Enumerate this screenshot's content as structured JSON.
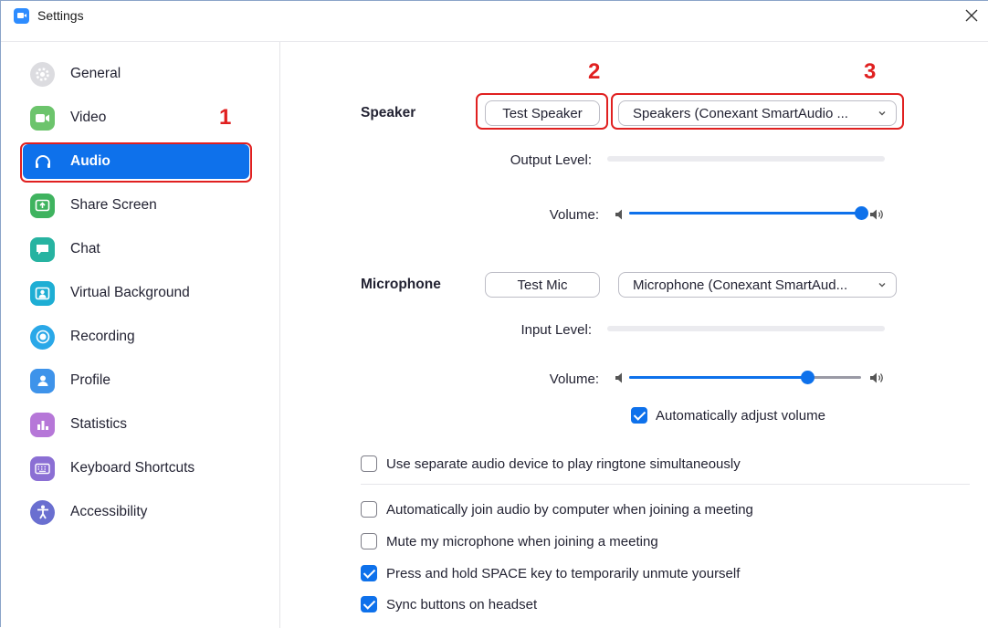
{
  "window": {
    "title": "Settings",
    "close_symbol": "✕"
  },
  "sidebar": {
    "items": [
      {
        "label": "General",
        "icon": "gear-icon",
        "color": "#d8d8dc"
      },
      {
        "label": "Video",
        "icon": "video-camera-icon",
        "color": "#6cc46c"
      },
      {
        "label": "Audio",
        "icon": "headphones-icon",
        "color": "#0e71eb",
        "active": true
      },
      {
        "label": "Share Screen",
        "icon": "share-screen-icon",
        "color": "#3fb35f"
      },
      {
        "label": "Chat",
        "icon": "chat-bubble-icon",
        "color": "#27b3a1"
      },
      {
        "label": "Virtual Background",
        "icon": "virtual-background-icon",
        "color": "#1eaed4"
      },
      {
        "label": "Recording",
        "icon": "record-icon",
        "color": "#2aa8e8"
      },
      {
        "label": "Profile",
        "icon": "profile-icon",
        "color": "#3e93ea"
      },
      {
        "label": "Statistics",
        "icon": "statistics-icon",
        "color": "#b677d8"
      },
      {
        "label": "Keyboard Shortcuts",
        "icon": "keyboard-icon",
        "color": "#8b6fd4"
      },
      {
        "label": "Accessibility",
        "icon": "accessibility-icon",
        "color": "#6a6fd0"
      }
    ]
  },
  "annotations": {
    "one": "1",
    "two": "2",
    "three": "3",
    "color": "#e02020"
  },
  "speaker": {
    "section_label": "Speaker",
    "test_button": "Test Speaker",
    "device": "Speakers (Conexant SmartAudio ...",
    "output_level_label": "Output Level:",
    "volume_label": "Volume:",
    "volume": 1.0
  },
  "microphone": {
    "section_label": "Microphone",
    "test_button": "Test Mic",
    "device": "Microphone (Conexant SmartAud...",
    "input_level_label": "Input Level:",
    "volume_label": "Volume:",
    "volume": 0.77,
    "auto_adjust_label": "Automatically adjust volume",
    "auto_adjust_checked": true
  },
  "options": [
    {
      "label": "Use separate audio device to play ringtone simultaneously",
      "checked": false
    },
    {
      "label": "Automatically join audio by computer when joining a meeting",
      "checked": false
    },
    {
      "label": "Mute my microphone when joining a meeting",
      "checked": false
    },
    {
      "label": "Press and hold SPACE key to temporarily unmute yourself",
      "checked": true
    },
    {
      "label": "Sync buttons on headset",
      "checked": true
    }
  ],
  "accent_color": "#0e71eb"
}
